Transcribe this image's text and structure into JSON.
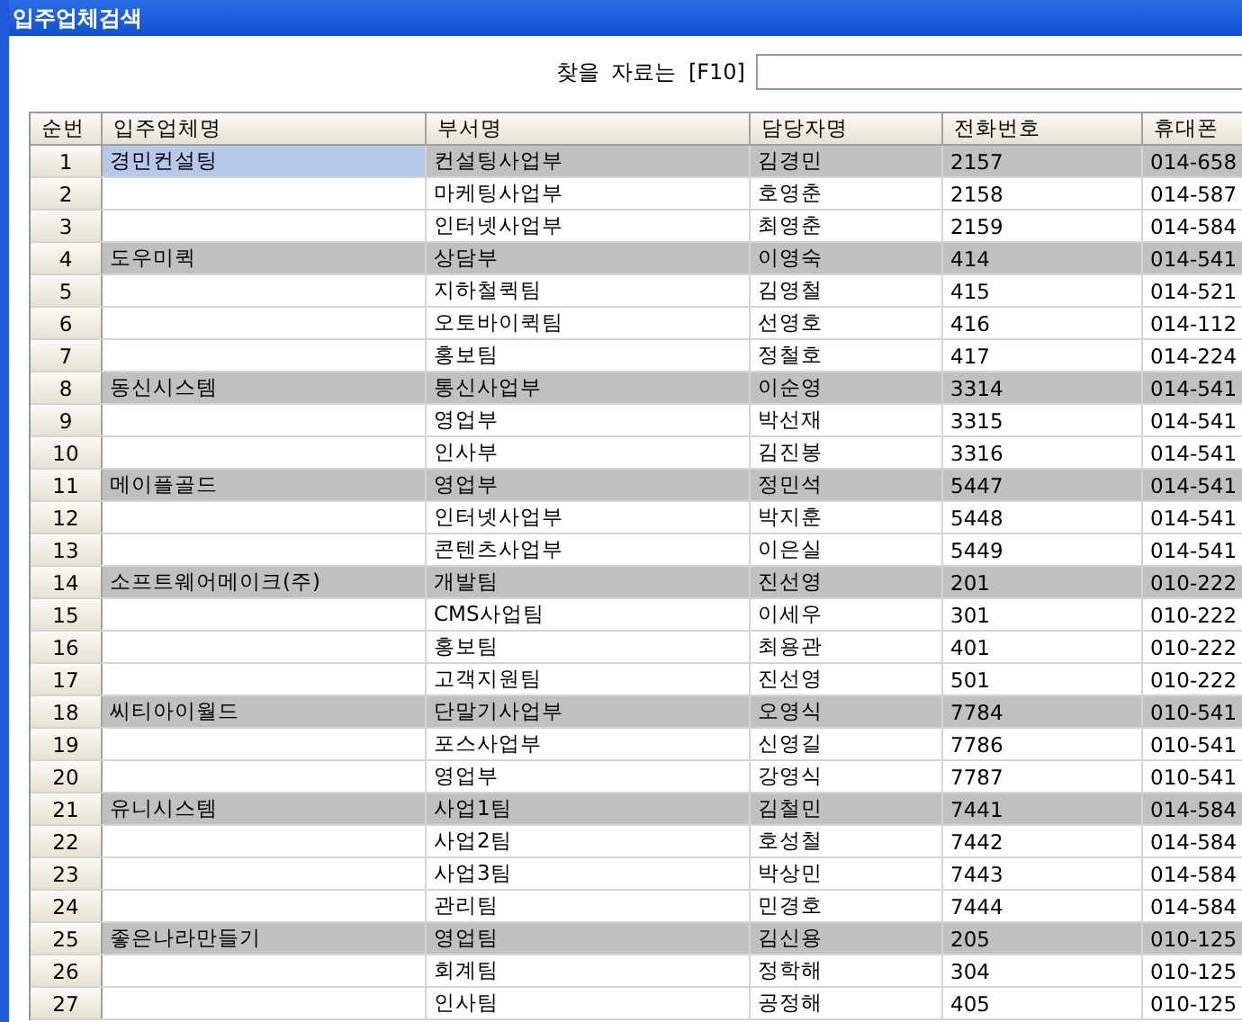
{
  "window": {
    "title": "입주업체검색"
  },
  "search": {
    "label": "찾을 자료는 [F10]"
  },
  "table": {
    "columns": [
      "순번",
      "입주업체명",
      "부서명",
      "담당자명",
      "전화번호",
      "휴대폰"
    ],
    "rows": [
      {
        "no": "1",
        "company": "경민컨설팅",
        "dept": "컨설팅사업부",
        "contact": "김경민",
        "phone": "2157",
        "mobile": "014-658",
        "shaded": true,
        "selected": true
      },
      {
        "no": "2",
        "company": "",
        "dept": "마케팅사업부",
        "contact": "호영춘",
        "phone": "2158",
        "mobile": "014-587",
        "shaded": false,
        "selected": false
      },
      {
        "no": "3",
        "company": "",
        "dept": "인터넷사업부",
        "contact": "최영춘",
        "phone": "2159",
        "mobile": "014-584",
        "shaded": false,
        "selected": false
      },
      {
        "no": "4",
        "company": "도우미퀵",
        "dept": "상담부",
        "contact": "이영숙",
        "phone": "414",
        "mobile": "014-541",
        "shaded": true,
        "selected": false
      },
      {
        "no": "5",
        "company": "",
        "dept": "지하철퀵팀",
        "contact": "김영철",
        "phone": "415",
        "mobile": "014-521",
        "shaded": false,
        "selected": false
      },
      {
        "no": "6",
        "company": "",
        "dept": "오토바이퀵팀",
        "contact": "선영호",
        "phone": "416",
        "mobile": "014-112",
        "shaded": false,
        "selected": false
      },
      {
        "no": "7",
        "company": "",
        "dept": "홍보팀",
        "contact": "정철호",
        "phone": "417",
        "mobile": "014-224",
        "shaded": false,
        "selected": false
      },
      {
        "no": "8",
        "company": "동신시스템",
        "dept": "통신사업부",
        "contact": "이순영",
        "phone": "3314",
        "mobile": "014-541",
        "shaded": true,
        "selected": false
      },
      {
        "no": "9",
        "company": "",
        "dept": "영업부",
        "contact": "박선재",
        "phone": "3315",
        "mobile": "014-541",
        "shaded": false,
        "selected": false
      },
      {
        "no": "10",
        "company": "",
        "dept": "인사부",
        "contact": "김진봉",
        "phone": "3316",
        "mobile": "014-541",
        "shaded": false,
        "selected": false
      },
      {
        "no": "11",
        "company": "메이플골드",
        "dept": "영업부",
        "contact": "정민석",
        "phone": "5447",
        "mobile": "014-541",
        "shaded": true,
        "selected": false
      },
      {
        "no": "12",
        "company": "",
        "dept": "인터넷사업부",
        "contact": "박지훈",
        "phone": "5448",
        "mobile": "014-541",
        "shaded": false,
        "selected": false
      },
      {
        "no": "13",
        "company": "",
        "dept": "콘텐츠사업부",
        "contact": "이은실",
        "phone": "5449",
        "mobile": "014-541",
        "shaded": false,
        "selected": false
      },
      {
        "no": "14",
        "company": "소프트웨어메이크(주)",
        "dept": "개발팀",
        "contact": "진선영",
        "phone": "201",
        "mobile": "010-222",
        "shaded": true,
        "selected": false
      },
      {
        "no": "15",
        "company": "",
        "dept": "CMS사업팀",
        "contact": "이세우",
        "phone": "301",
        "mobile": "010-222",
        "shaded": false,
        "selected": false
      },
      {
        "no": "16",
        "company": "",
        "dept": "홍보팀",
        "contact": "최용관",
        "phone": "401",
        "mobile": "010-222",
        "shaded": false,
        "selected": false
      },
      {
        "no": "17",
        "company": "",
        "dept": "고객지원팀",
        "contact": "진선영",
        "phone": "501",
        "mobile": "010-222",
        "shaded": false,
        "selected": false
      },
      {
        "no": "18",
        "company": "씨티아이월드",
        "dept": "단말기사업부",
        "contact": "오영식",
        "phone": "7784",
        "mobile": "010-541",
        "shaded": true,
        "selected": false
      },
      {
        "no": "19",
        "company": "",
        "dept": "포스사업부",
        "contact": "신영길",
        "phone": "7786",
        "mobile": "010-541",
        "shaded": false,
        "selected": false
      },
      {
        "no": "20",
        "company": "",
        "dept": "영업부",
        "contact": "강영식",
        "phone": "7787",
        "mobile": "010-541",
        "shaded": false,
        "selected": false
      },
      {
        "no": "21",
        "company": "유니시스템",
        "dept": "사업1팀",
        "contact": "김철민",
        "phone": "7441",
        "mobile": "014-584",
        "shaded": true,
        "selected": false
      },
      {
        "no": "22",
        "company": "",
        "dept": "사업2팀",
        "contact": "호성철",
        "phone": "7442",
        "mobile": "014-584",
        "shaded": false,
        "selected": false
      },
      {
        "no": "23",
        "company": "",
        "dept": "사업3팀",
        "contact": "박상민",
        "phone": "7443",
        "mobile": "014-584",
        "shaded": false,
        "selected": false
      },
      {
        "no": "24",
        "company": "",
        "dept": "관리팀",
        "contact": "민경호",
        "phone": "7444",
        "mobile": "014-584",
        "shaded": false,
        "selected": false
      },
      {
        "no": "25",
        "company": "좋은나라만들기",
        "dept": "영업팀",
        "contact": "김신용",
        "phone": "205",
        "mobile": "010-125",
        "shaded": true,
        "selected": false
      },
      {
        "no": "26",
        "company": "",
        "dept": "회계팀",
        "contact": "정학해",
        "phone": "304",
        "mobile": "010-125",
        "shaded": false,
        "selected": false
      },
      {
        "no": "27",
        "company": "",
        "dept": "인사팀",
        "contact": "공정해",
        "phone": "405",
        "mobile": "010-125",
        "shaded": false,
        "selected": false
      }
    ]
  }
}
